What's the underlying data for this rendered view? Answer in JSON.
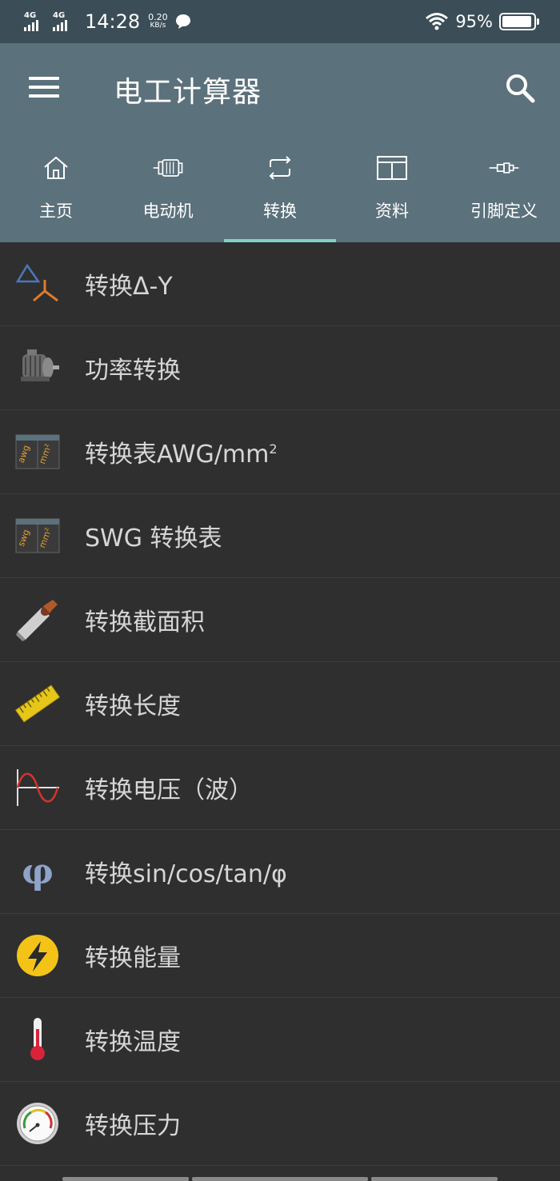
{
  "status_bar": {
    "signal1": "4G",
    "signal2": "4G",
    "time": "14:28",
    "speed_value": "0.20",
    "speed_unit": "KB/s",
    "battery_percent": "95%",
    "battery_level": 0.95
  },
  "app_bar": {
    "title": "电工计算器",
    "menu_icon": "hamburger-menu-icon",
    "search_icon": "search-icon"
  },
  "tabs": [
    {
      "label": "主页",
      "icon": "home-icon",
      "active": false
    },
    {
      "label": "电动机",
      "icon": "motor-icon",
      "active": false
    },
    {
      "label": "转换",
      "icon": "convert-icon",
      "active": true
    },
    {
      "label": "资料",
      "icon": "table-icon",
      "active": false
    },
    {
      "label": "引脚定义",
      "icon": "connector-icon",
      "active": false
    }
  ],
  "list": [
    {
      "label": "转换Δ-Y",
      "icon": "delta-wye-icon"
    },
    {
      "label": "功率转换",
      "icon": "motor-photo-icon"
    },
    {
      "label": "转换表AWG/mm",
      "sup": "2",
      "icon": "awg-table-icon"
    },
    {
      "label": "SWG 转换表",
      "icon": "swg-table-icon"
    },
    {
      "label": "转换截面积",
      "icon": "wire-cross-section-icon"
    },
    {
      "label": "转换长度",
      "icon": "ruler-icon"
    },
    {
      "label": "转换电压（波）",
      "icon": "sine-wave-icon"
    },
    {
      "label": "转换sin/cos/tan/φ",
      "icon": "phi-icon"
    },
    {
      "label": "转换能量",
      "icon": "lightning-icon"
    },
    {
      "label": "转换温度",
      "icon": "thermometer-icon"
    },
    {
      "label": "转换压力",
      "icon": "pressure-gauge-icon"
    }
  ],
  "icon_text": {
    "awg": "awg",
    "swg": "swg",
    "mm2": "mm²",
    "phi": "φ"
  },
  "colors": {
    "status_bar": "#3b4d57",
    "app_bar": "#5b717c",
    "tab_indicator": "#7fd3c7",
    "background": "#2f2f2f",
    "list_text": "#d6d6d6"
  }
}
